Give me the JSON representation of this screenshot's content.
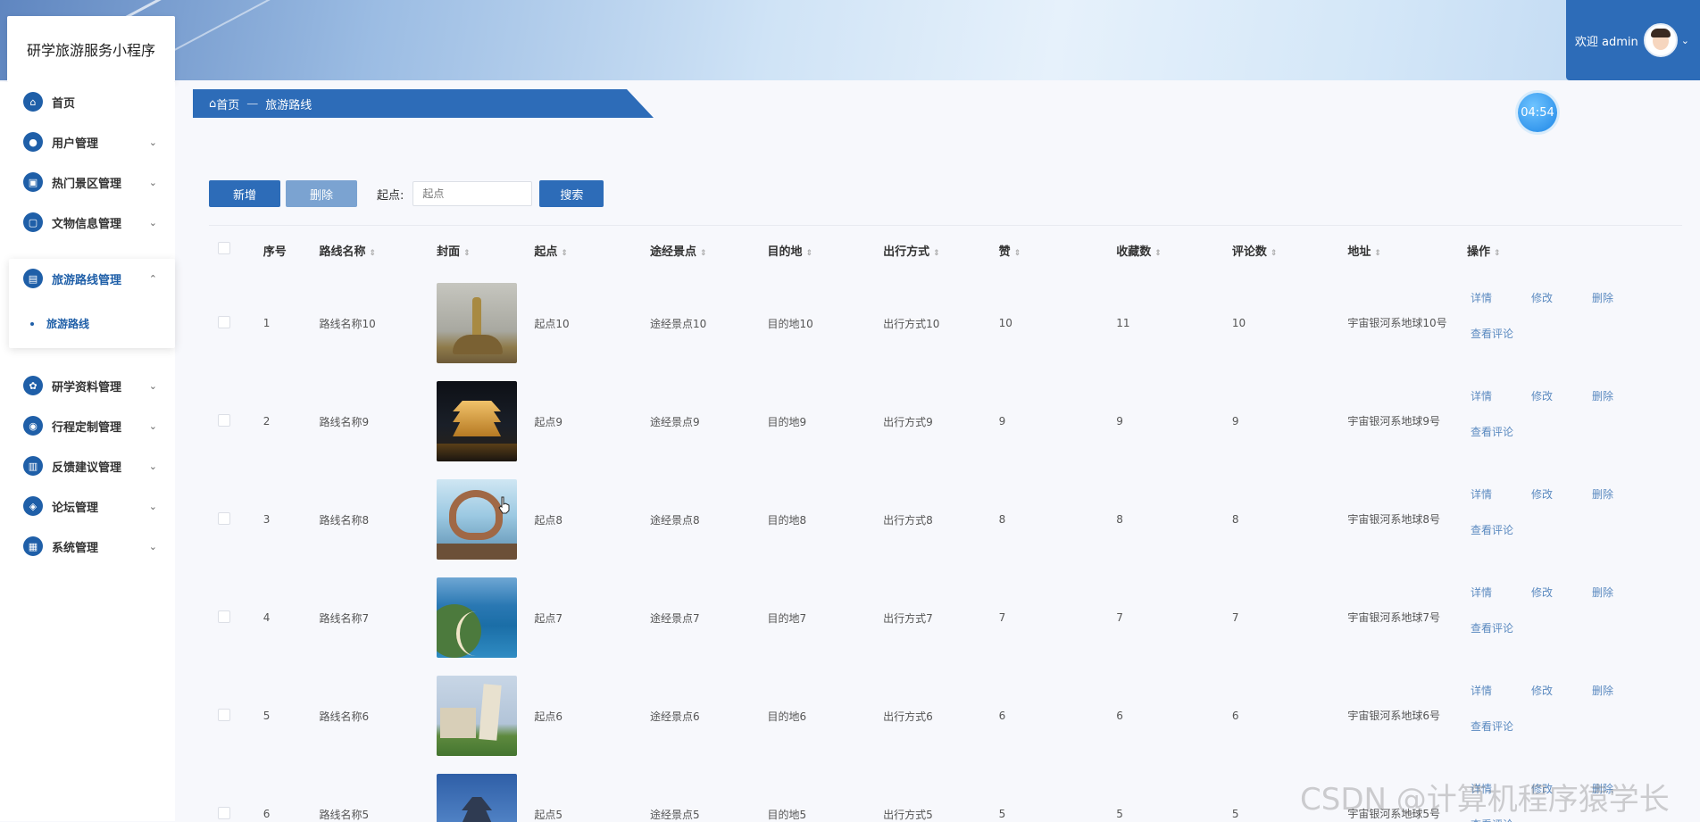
{
  "app": {
    "title": "研学旅游服务小程序",
    "welcome": "欢迎 admin",
    "timer": "04:54",
    "watermark": "CSDN @计算机程序猿学长"
  },
  "sidebar": {
    "items": [
      {
        "label": "首页",
        "icon": "home-icon",
        "expandable": false
      },
      {
        "label": "用户管理",
        "icon": "user-icon",
        "expandable": true
      },
      {
        "label": "热门景区管理",
        "icon": "scenic-icon",
        "expandable": true
      },
      {
        "label": "文物信息管理",
        "icon": "relic-icon",
        "expandable": true
      },
      {
        "label": "旅游路线管理",
        "icon": "route-icon",
        "expandable": true,
        "expanded": true
      },
      {
        "label": "研学资料管理",
        "icon": "material-icon",
        "expandable": true
      },
      {
        "label": "行程定制管理",
        "icon": "itinerary-icon",
        "expandable": true
      },
      {
        "label": "反馈建议管理",
        "icon": "feedback-icon",
        "expandable": true
      },
      {
        "label": "论坛管理",
        "icon": "forum-icon",
        "expandable": true
      },
      {
        "label": "系统管理",
        "icon": "system-icon",
        "expandable": true
      }
    ],
    "subitem": "旅游路线"
  },
  "breadcrumb": {
    "home": "首页",
    "sep": "—",
    "current": "旅游路线"
  },
  "toolbar": {
    "add_label": "新增",
    "delete_label": "删除",
    "filter_label": "起点:",
    "filter_placeholder": "起点",
    "search_label": "搜索"
  },
  "table": {
    "columns": [
      "序号",
      "路线名称",
      "封面",
      "起点",
      "途经景点",
      "目的地",
      "出行方式",
      "赞",
      "收藏数",
      "评论数",
      "地址",
      "操作"
    ],
    "rows": [
      {
        "idx": "1",
        "name": "路线名称10",
        "start": "起点10",
        "via": "途经景点10",
        "dest": "目的地10",
        "mode": "出行方式10",
        "likes": "10",
        "favs": "11",
        "comments": "10",
        "addr": "宇宙银河系地球10号"
      },
      {
        "idx": "2",
        "name": "路线名称9",
        "start": "起点9",
        "via": "途经景点9",
        "dest": "目的地9",
        "mode": "出行方式9",
        "likes": "9",
        "favs": "9",
        "comments": "9",
        "addr": "宇宙银河系地球9号"
      },
      {
        "idx": "3",
        "name": "路线名称8",
        "start": "起点8",
        "via": "途经景点8",
        "dest": "目的地8",
        "mode": "出行方式8",
        "likes": "8",
        "favs": "8",
        "comments": "8",
        "addr": "宇宙银河系地球8号"
      },
      {
        "idx": "4",
        "name": "路线名称7",
        "start": "起点7",
        "via": "途经景点7",
        "dest": "目的地7",
        "mode": "出行方式7",
        "likes": "7",
        "favs": "7",
        "comments": "7",
        "addr": "宇宙银河系地球7号"
      },
      {
        "idx": "5",
        "name": "路线名称6",
        "start": "起点6",
        "via": "途经景点6",
        "dest": "目的地6",
        "mode": "出行方式6",
        "likes": "6",
        "favs": "6",
        "comments": "6",
        "addr": "宇宙银河系地球6号"
      },
      {
        "idx": "6",
        "name": "路线名称5",
        "start": "起点5",
        "via": "途经景点5",
        "dest": "目的地5",
        "mode": "出行方式5",
        "likes": "5",
        "favs": "5",
        "comments": "5",
        "addr": "宇宙银河系地球5号"
      }
    ],
    "ops": {
      "detail": "详情",
      "edit": "修改",
      "delete": "删除",
      "comments": "查看评论"
    }
  },
  "colors": {
    "primary": "#2d6cb8",
    "link": "#5b8ac0",
    "disabled_button": "#7ba3d1"
  }
}
